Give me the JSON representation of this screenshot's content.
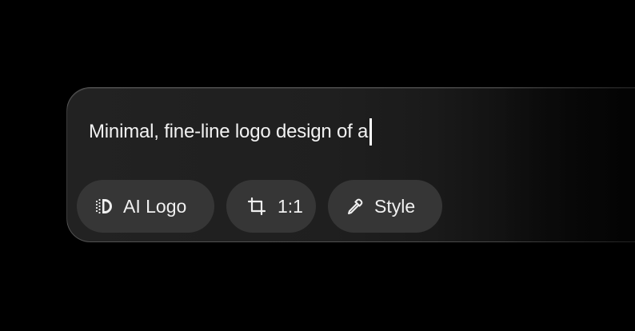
{
  "prompt": {
    "text": "Minimal, fine-line logo design of a"
  },
  "chips": [
    {
      "label": "AI Logo",
      "icon": "ai-logo-icon"
    },
    {
      "label": "1:1",
      "icon": "crop-icon"
    },
    {
      "label": "Style",
      "icon": "eyedropper-icon"
    }
  ],
  "colors": {
    "background": "#000000",
    "card": "#222222",
    "chip": "#363636",
    "text": "#f2f2f2"
  }
}
